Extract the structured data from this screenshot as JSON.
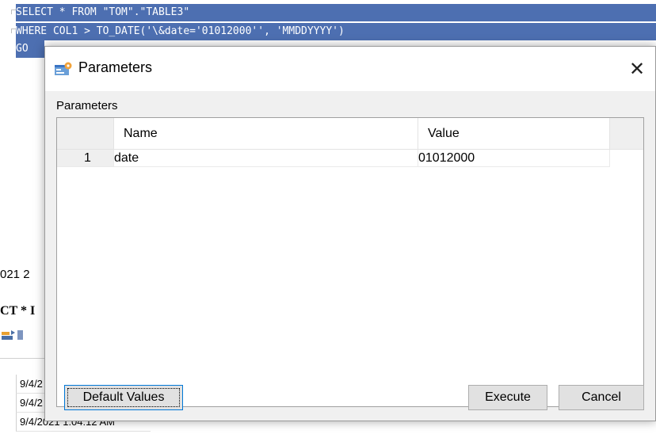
{
  "editor": {
    "lines": [
      "SELECT * FROM \"TOM\".\"TABLE3\"",
      "WHERE COL1 > TO_DATE('\\&date='01012000'', 'MMDDYYYY')",
      "GO"
    ],
    "selection_color": "#4d6fb1"
  },
  "background": {
    "timestamp_partial": "021 2",
    "sql_snippet": "CT * I",
    "grid_rows": [
      "9/4/2",
      "9/4/2",
      "9/4/2021 1:04:12 AM"
    ]
  },
  "dialog": {
    "title": "Parameters",
    "title_icon": "parameters-icon",
    "close_glyph": "✕",
    "group_label": "Parameters",
    "table": {
      "columns": [
        "Name",
        "Value"
      ],
      "rows": [
        {
          "num": "1",
          "name": "date",
          "value": "01012000"
        }
      ]
    },
    "buttons": {
      "default_values": "Default Values",
      "execute": "Execute",
      "cancel": "Cancel"
    }
  }
}
